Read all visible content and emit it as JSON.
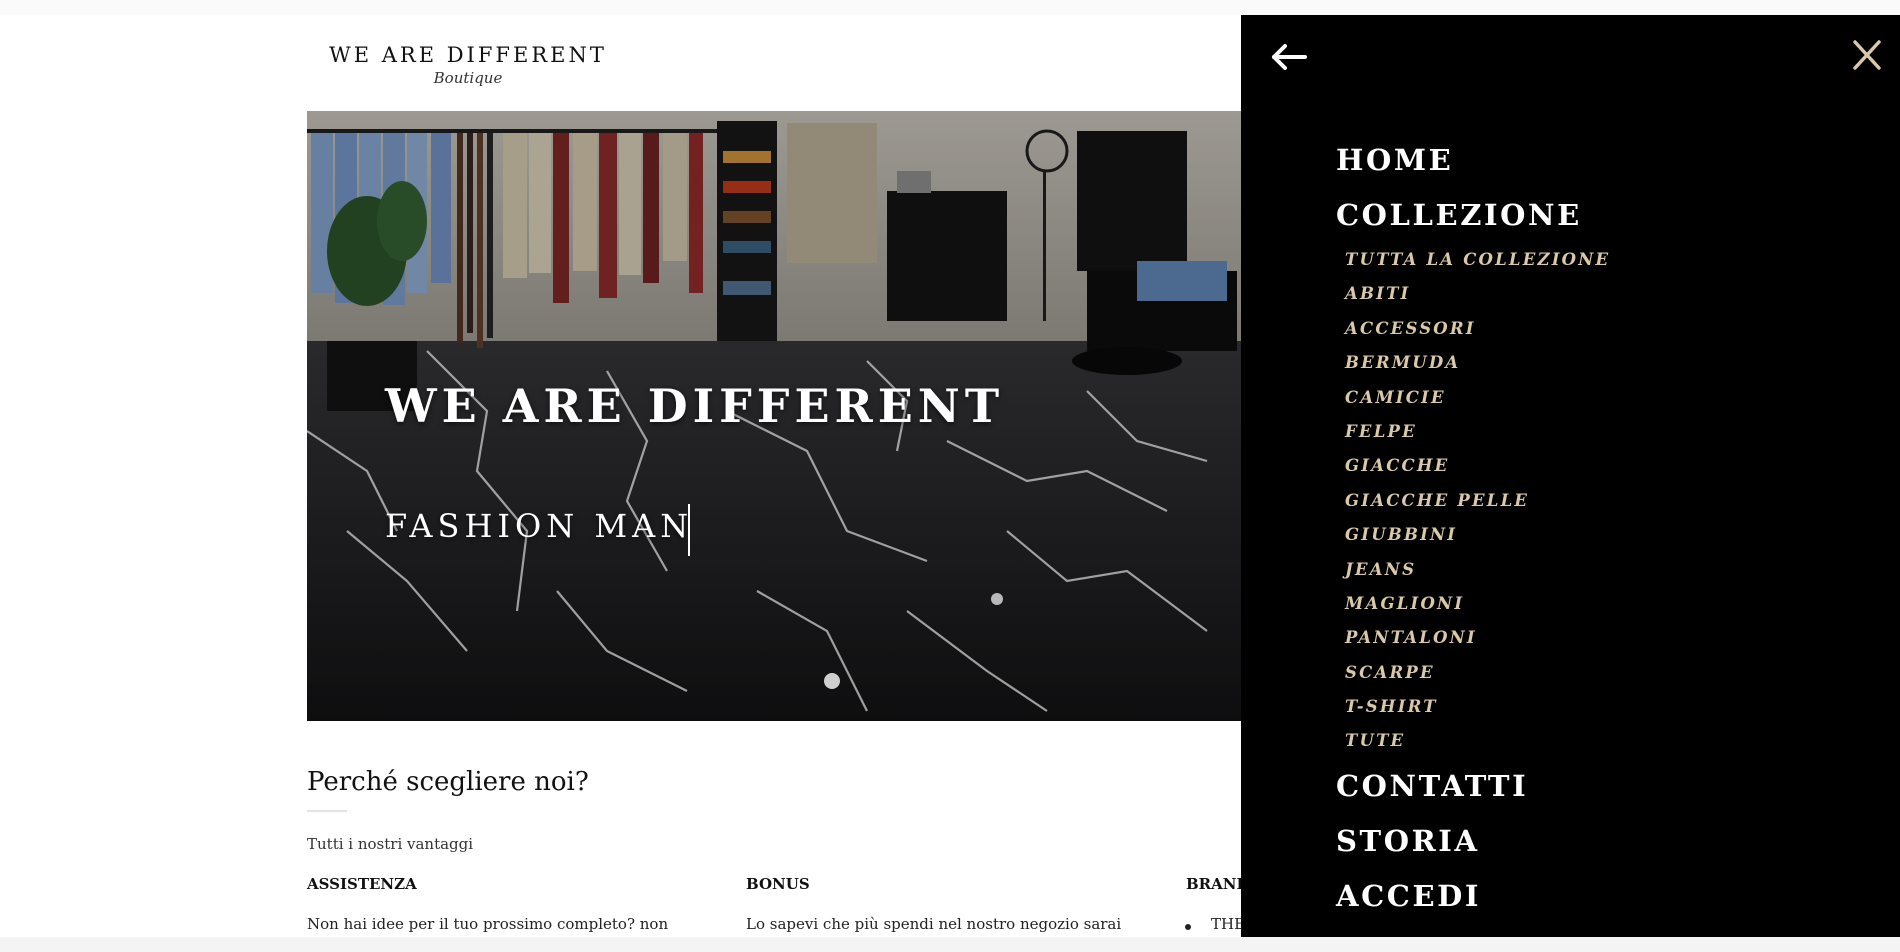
{
  "logo": {
    "main": "WE ARE DIFFERENT",
    "sub": "Boutique"
  },
  "hero": {
    "title": "WE ARE DIFFERENT",
    "subtitle": "FASHION MAN"
  },
  "why": {
    "title": "Perché scegliere noi?",
    "subtitle": "Tutti i nostri vantaggi",
    "columns": [
      {
        "heading": "ASSISTENZA",
        "text": "Non hai idee per il tuo prossimo completo? non"
      },
      {
        "heading": "BONUS",
        "text": "Lo sapevi che più spendi nel nostro negozio sarai"
      },
      {
        "heading": "BRAND",
        "text": "THE"
      }
    ]
  },
  "drawer": {
    "back_icon": "arrow-left-icon",
    "close_icon": "close-icon",
    "accent_color": "#d9c9a8",
    "menu": {
      "home": "HOME",
      "collezione": "COLLEZIONE",
      "sub_items": [
        "TUTTA LA COLLEZIONE",
        "ABITI",
        "ACCESSORI",
        "BERMUDA",
        "CAMICIE",
        "FELPE",
        "GIACCHE",
        "GIACCHE PELLE",
        "GIUBBINI",
        "JEANS",
        "MAGLIONI",
        "PANTALONI",
        "SCARPE",
        "T-SHIRT",
        "TUTE"
      ],
      "contatti": "CONTATTI",
      "storia": "STORIA",
      "accedi": "ACCEDI"
    }
  }
}
